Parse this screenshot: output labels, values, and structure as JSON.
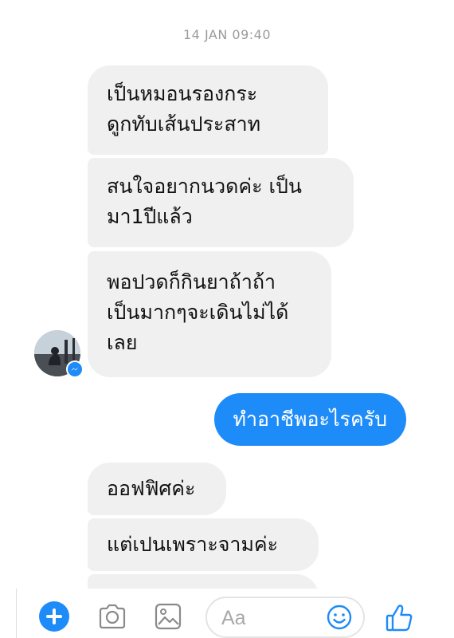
{
  "conversation": {
    "timestamp": "14 JAN 09:40",
    "messages": [
      {
        "sender": "contact",
        "text": "เป็นหมอนรองกระ\nดูกทับเส้นประสาท"
      },
      {
        "sender": "contact",
        "text": "สนใจอยากนวดค่ะ เป็น\nมา1ปีแล้ว"
      },
      {
        "sender": "contact",
        "text": "พอปวดก็กินยาถ้าถ้า\nเป็นมากๆจะเดินไม่ได้\nเลย"
      },
      {
        "sender": "me",
        "text": "ทำอาชีพอะไรครับ"
      },
      {
        "sender": "contact",
        "text": "ออฟฟิศค่ะ"
      },
      {
        "sender": "contact",
        "text": "แต่เปนเพราะจามค่ะ"
      },
      {
        "sender": "contact",
        "text": ""
      }
    ],
    "avatar_badge_icon": "messenger-icon"
  },
  "composer": {
    "placeholder": "Aa",
    "icons": {
      "add": "plus-icon",
      "camera": "camera-icon",
      "gallery": "image-icon",
      "emoji": "smiley-icon",
      "like": "thumbs-up-icon"
    }
  },
  "colors": {
    "accent": "#1d8bf8",
    "incoming_bubble": "#f0f0f0",
    "timestamp": "#9a9a9a"
  }
}
